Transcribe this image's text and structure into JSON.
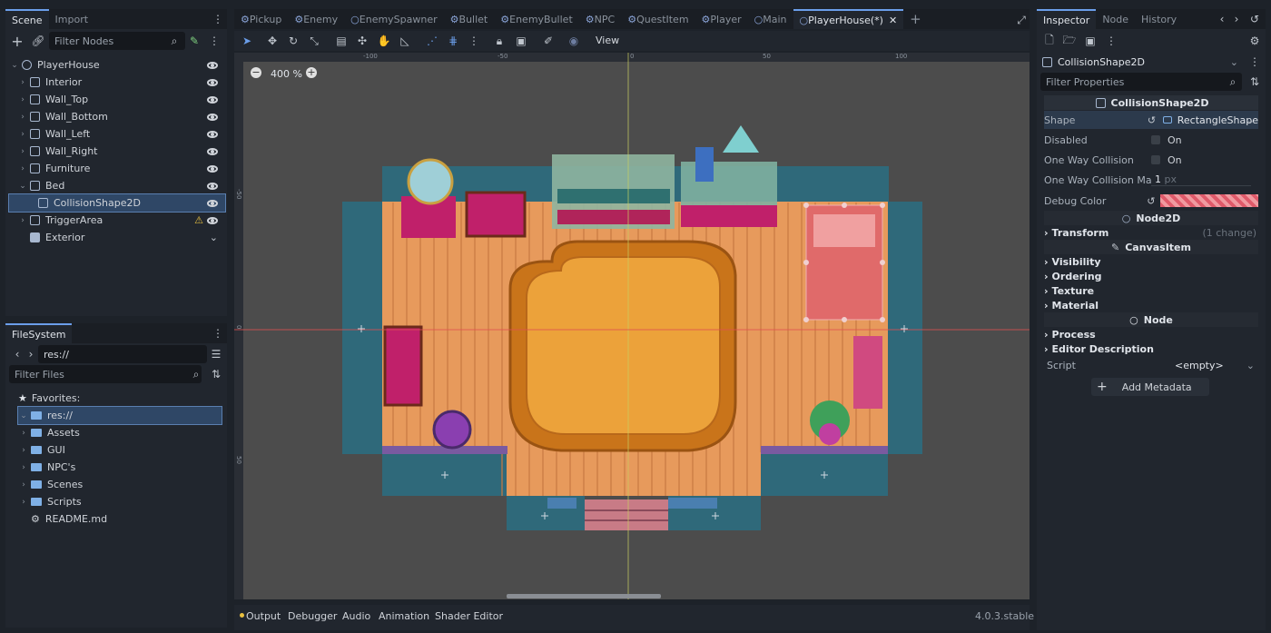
{
  "scene_dock": {
    "tabs": [
      "Scene",
      "Import"
    ],
    "filter_placeholder": "Filter Nodes",
    "nodes": [
      {
        "label": "PlayerHouse",
        "indent": 0
      },
      {
        "label": "Interior",
        "indent": 1
      },
      {
        "label": "Wall_Top",
        "indent": 1
      },
      {
        "label": "Wall_Bottom",
        "indent": 1
      },
      {
        "label": "Wall_Left",
        "indent": 1
      },
      {
        "label": "Wall_Right",
        "indent": 1
      },
      {
        "label": "Furniture",
        "indent": 1
      },
      {
        "label": "Bed",
        "indent": 1
      },
      {
        "label": "CollisionShape2D",
        "indent": 2
      },
      {
        "label": "TriggerArea",
        "indent": 1
      },
      {
        "label": "Exterior",
        "indent": 1
      }
    ]
  },
  "filesystem": {
    "tab": "FileSystem",
    "path": "res://",
    "filter_placeholder": "Filter Files",
    "favorites": "Favorites:",
    "root": "res://",
    "items": [
      "Assets",
      "GUI",
      "NPC's",
      "Scenes",
      "Scripts",
      "README.md"
    ]
  },
  "editor": {
    "tabs": [
      "Pickup",
      "Enemy",
      "EnemySpawner",
      "Bullet",
      "EnemyBullet",
      "NPC",
      "QuestItem",
      "Player",
      "Main",
      "PlayerHouse(*)"
    ],
    "view_menu": "View",
    "zoom": "400 %",
    "ruler_labels": [
      "-100",
      "-50",
      "0",
      "50",
      "100"
    ],
    "ruler_v_labels": [
      "-50",
      "0",
      "50"
    ]
  },
  "bottom": {
    "tabs": [
      "Output",
      "Debugger",
      "Audio",
      "Animation",
      "Shader Editor"
    ],
    "version": "4.0.3.stable"
  },
  "inspector": {
    "tabs": [
      "Inspector",
      "Node",
      "History"
    ],
    "object": "CollisionShape2D",
    "filter_placeholder": "Filter Properties",
    "class_header": "CollisionShape2D",
    "shape_label": "Shape",
    "shape_value": "RectangleShape",
    "disabled_label": "Disabled",
    "disabled_value": "On",
    "oneway_label": "One Way Collision",
    "oneway_value": "On",
    "margin_label": "One Way Collision Ma...",
    "margin_value": "1",
    "margin_unit": "px",
    "debug_label": "Debug Color",
    "node2d_header": "Node2D",
    "transform": "Transform",
    "transform_note": "(1 change)",
    "canvas_header": "CanvasItem",
    "visibility": "Visibility",
    "ordering": "Ordering",
    "texture": "Texture",
    "material": "Material",
    "node_header": "Node",
    "process": "Process",
    "editor_desc": "Editor Description",
    "script_label": "Script",
    "script_value": "<empty>",
    "add_metadata": "Add Metadata",
    "colors": {
      "accent": "#6b9eea",
      "debug": "#e05a6a"
    }
  }
}
